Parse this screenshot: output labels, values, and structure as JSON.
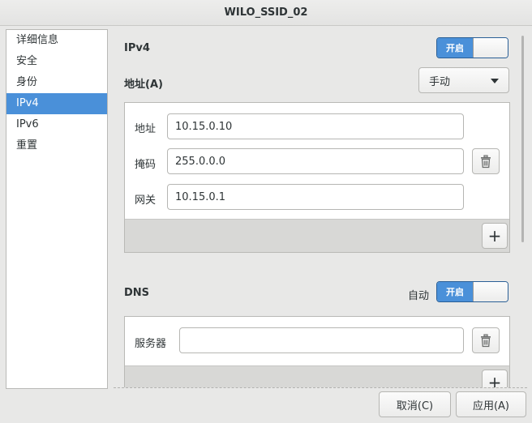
{
  "window": {
    "title": "WILO_SSID_02"
  },
  "sidebar": {
    "items": [
      {
        "label": "详细信息"
      },
      {
        "label": "安全"
      },
      {
        "label": "身份"
      },
      {
        "label": "IPv4"
      },
      {
        "label": "IPv6"
      },
      {
        "label": "重置"
      }
    ],
    "selected": "IPv4"
  },
  "ipv4": {
    "title": "IPv4",
    "toggle_label": "开启",
    "enabled": true,
    "address_method_label": "地址(A)",
    "address_method_value": "手动",
    "fields": {
      "address_label": "地址",
      "address_value": "10.15.0.10",
      "netmask_label": "掩码",
      "netmask_value": "255.0.0.0",
      "gateway_label": "网关",
      "gateway_value": "10.15.0.1"
    },
    "add_label": "+"
  },
  "dns": {
    "title": "DNS",
    "auto_label": "自动",
    "toggle_label": "开启",
    "enabled": true,
    "server_label": "服务器",
    "server_value": "",
    "add_label": "+"
  },
  "footer": {
    "cancel_label": "取消(C)",
    "apply_label": "应用(A)"
  },
  "colors": {
    "accent": "#4a90d9",
    "background": "#e8e8e7"
  }
}
